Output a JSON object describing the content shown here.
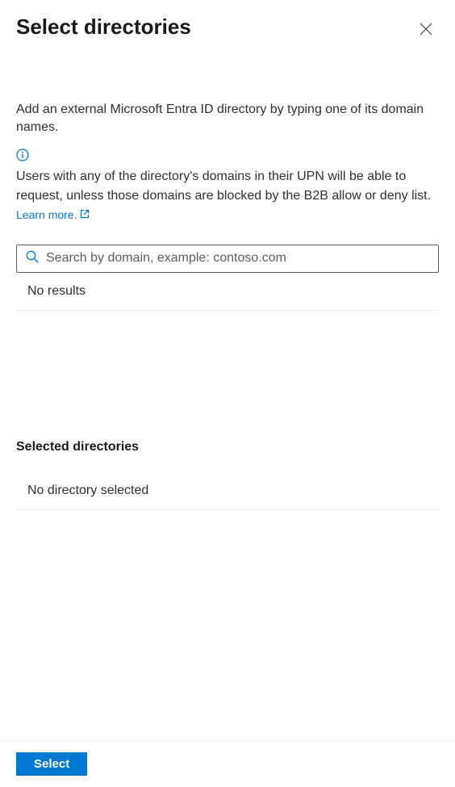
{
  "header": {
    "title": "Select directories"
  },
  "body": {
    "description": "Add an external Microsoft Entra ID directory by typing one of its domain names.",
    "info_text": "Users with any of the directory's domains in their UPN will be able to request, unless those domains are blocked by the B2B allow or deny list.",
    "learn_more_label": "Learn more.",
    "search_placeholder": "Search by domain, example: contoso.com",
    "no_results_text": "No results",
    "selected_heading": "Selected directories",
    "no_directory_text": "No directory selected"
  },
  "footer": {
    "select_label": "Select"
  }
}
